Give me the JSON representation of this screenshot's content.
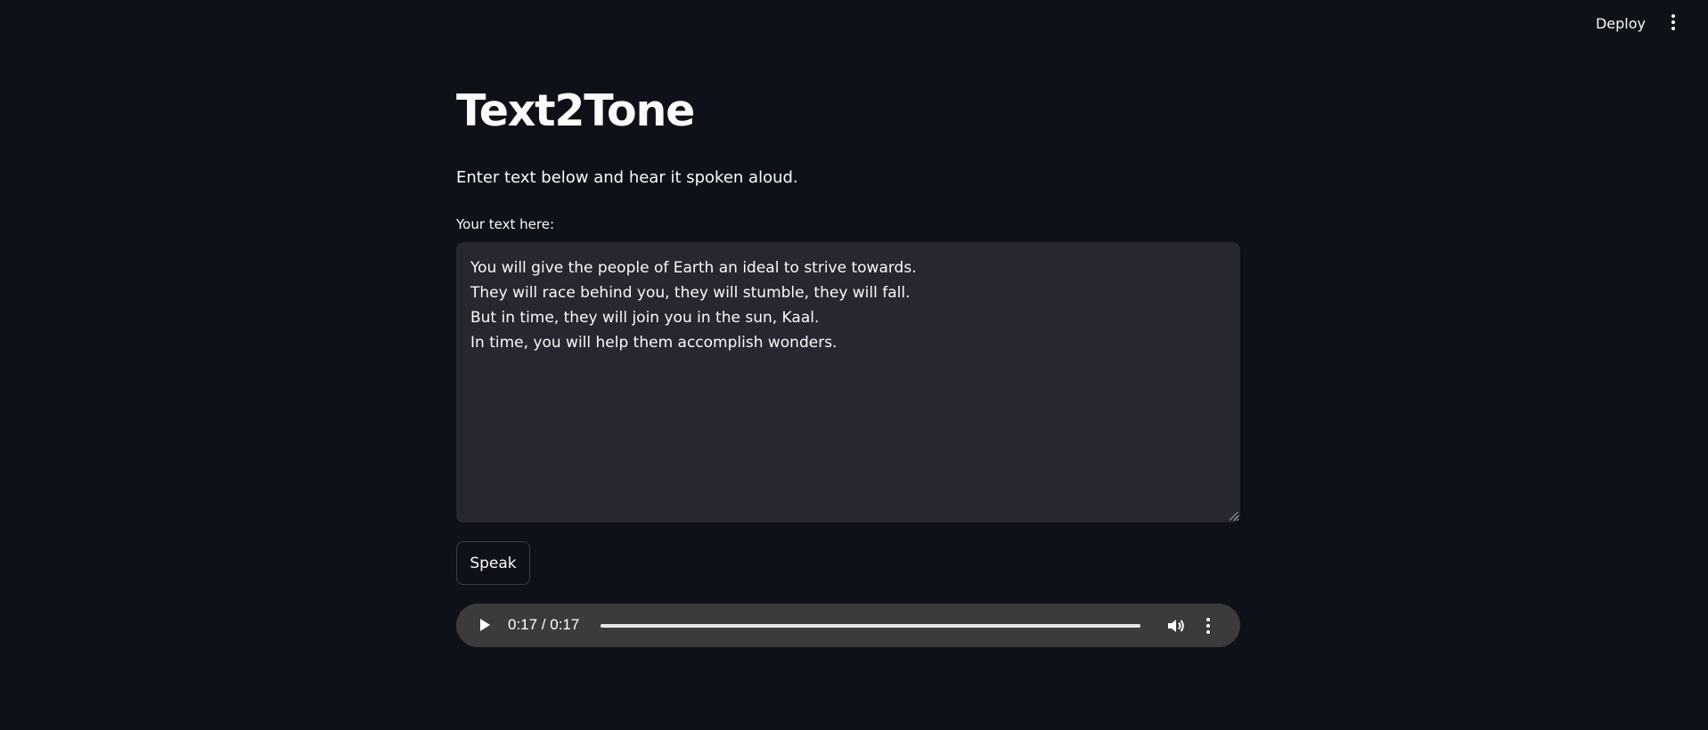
{
  "header": {
    "deploy_label": "Deploy",
    "menu_icon": "kebab-vertical-icon"
  },
  "main": {
    "title": "Text2Tone",
    "subtitle": "Enter text below and hear it spoken aloud.",
    "text_input": {
      "label": "Your text here:",
      "value": "You will give the people of Earth an ideal to strive towards.\nThey will race behind you, they will stumble, they will fall.\nBut in time, they will join you in the sun, Kaal.\nIn time, you will help them accomplish wonders."
    },
    "speak_button": "Speak",
    "audio_player": {
      "time_display": "0:17 / 0:17",
      "progress_fraction": 1.0,
      "play_icon": "play-icon",
      "volume_icon": "volume-icon",
      "menu_icon": "more-options-icon"
    }
  },
  "colors": {
    "background": "#0e1117",
    "input_background": "#262730",
    "text": "#fafafa",
    "audio_background": "#3b3b3b"
  }
}
